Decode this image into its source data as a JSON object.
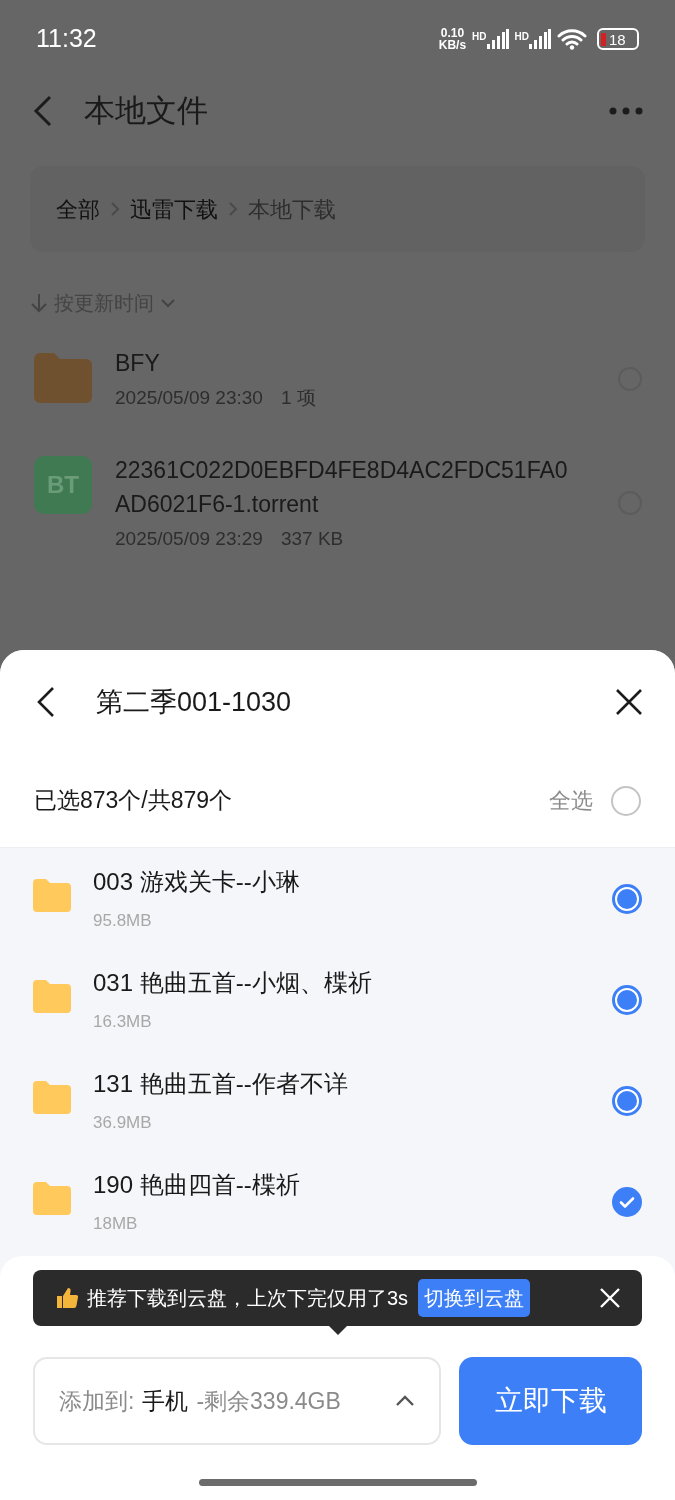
{
  "status_bar": {
    "time": "11:32",
    "speed_value": "0.10",
    "speed_unit": "KB/s",
    "signals": [
      "HD",
      "HD"
    ],
    "battery": "18"
  },
  "header": {
    "title": "本地文件"
  },
  "breadcrumb": [
    {
      "label": "全部",
      "selected": false
    },
    {
      "label": "迅雷下载",
      "selected": false
    },
    {
      "label": "本地下载",
      "selected": true
    }
  ],
  "sort": {
    "label": "按更新时间"
  },
  "files": [
    {
      "kind": "folder",
      "name": "BFY",
      "date": "2025/05/09 23:30",
      "info": "1 项",
      "selected": false
    },
    {
      "kind": "torrent",
      "badge": "BT",
      "name": "22361C022D0EBFD4FE8D4AC2FDC51FA0AD6021F6-1.torrent",
      "date": "2025/05/09 23:29",
      "info": "337 KB",
      "selected": false
    }
  ],
  "sheet": {
    "title": "第二季001-1030",
    "count": "已选873个/共879个",
    "select_all": {
      "label": "全选",
      "checked": false
    },
    "items": [
      {
        "name": "003 游戏关卡--小琳",
        "size": "95.8MB",
        "kind": "dot",
        "selected": true
      },
      {
        "name": "031 艳曲五首--小烟、楪祈",
        "size": "16.3MB",
        "kind": "dot",
        "selected": true
      },
      {
        "name": "131 艳曲五首--作者不详",
        "size": "36.9MB",
        "kind": "dot",
        "selected": true
      },
      {
        "name": "190 艳曲四首--楪祈",
        "size": "18MB",
        "kind": "tick",
        "selected": true
      }
    ],
    "tip": {
      "text": "推荐下载到云盘，上次下完仅用了3s",
      "action": "切换到云盘"
    },
    "destination": {
      "label": "添加到:",
      "device": "手机",
      "free": "-剩余339.4GB"
    },
    "download_button": "立即下载"
  }
}
